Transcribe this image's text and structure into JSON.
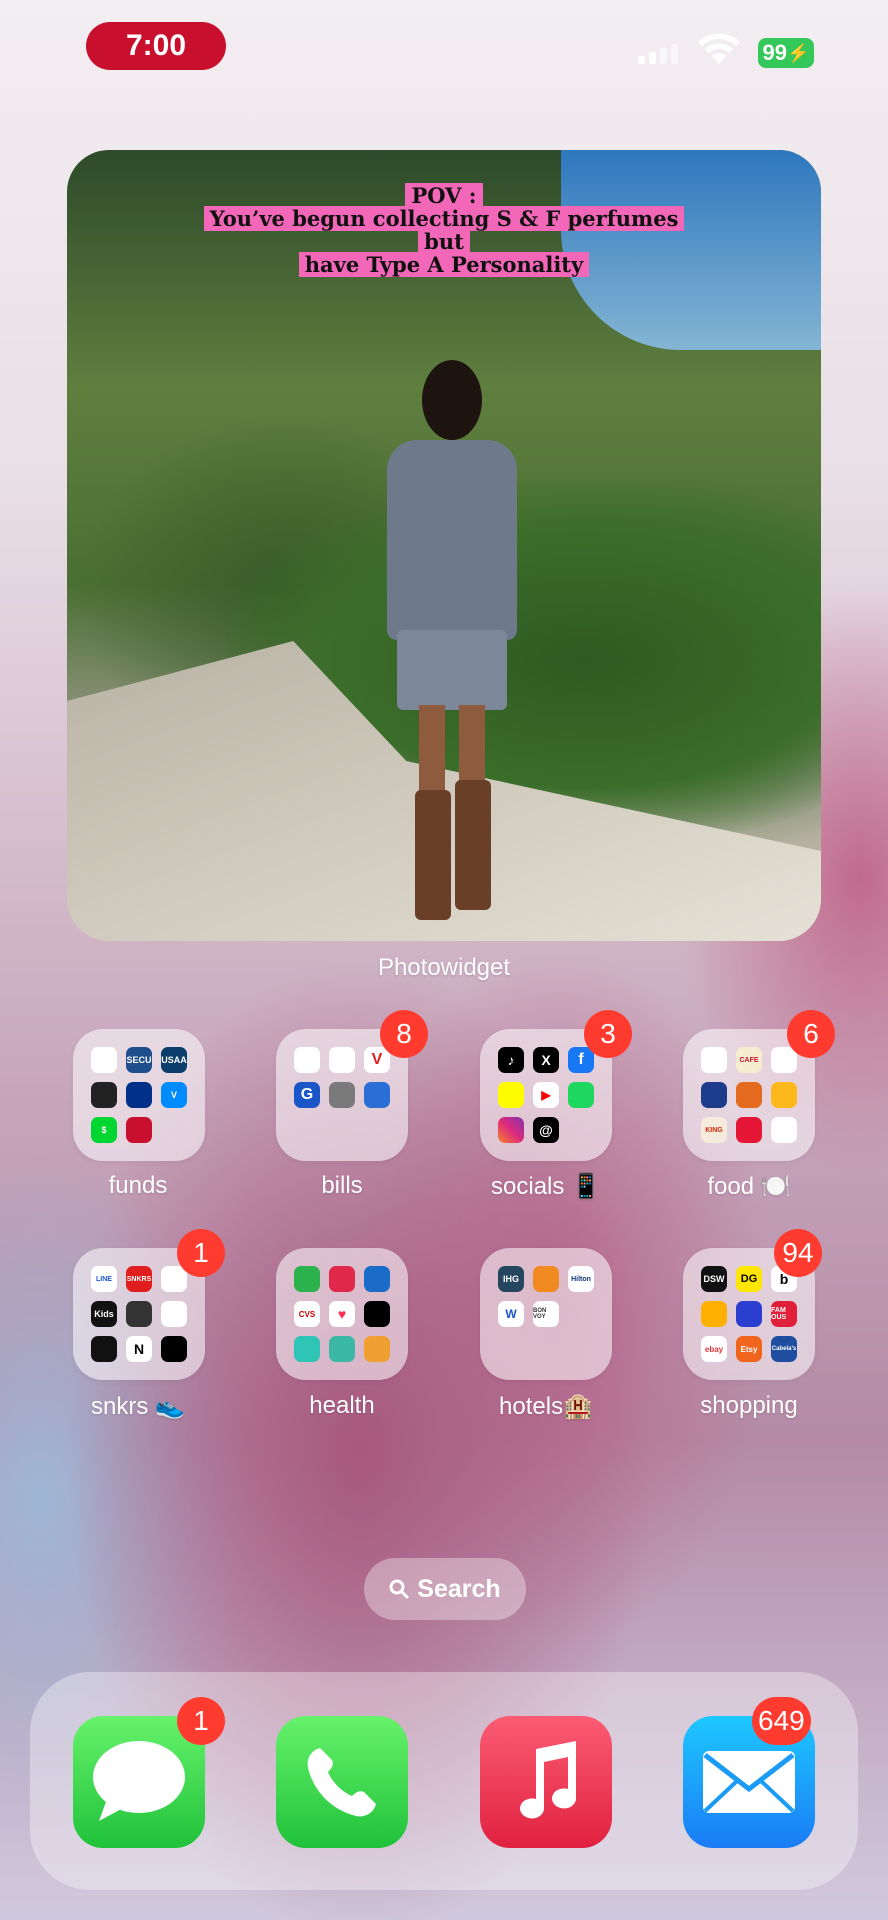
{
  "status_bar": {
    "time": "7:00",
    "battery": "99"
  },
  "widget": {
    "caption_lines": [
      "POV :",
      "You’ve begun collecting S & F perfumes",
      "but",
      "have Type A Personality"
    ],
    "label": "Photowidget"
  },
  "folders": [
    {
      "label": "funds",
      "badge": ""
    },
    {
      "label": "bills",
      "badge": "8"
    },
    {
      "label": "socials 📱",
      "badge": "3"
    },
    {
      "label": "food 🍽️",
      "badge": "6"
    },
    {
      "label": "snkrs 👟",
      "badge": "1"
    },
    {
      "label": "health",
      "badge": ""
    },
    {
      "label": "hotels🏨",
      "badge": ""
    },
    {
      "label": "shopping",
      "badge": "94"
    }
  ],
  "folder_icon_text": {
    "funds": [
      "",
      "SECU",
      "USAA",
      "",
      "",
      "V",
      "$",
      "",
      ""
    ],
    "bills": [
      "",
      "",
      "V",
      "G",
      "",
      "",
      "",
      "",
      ""
    ],
    "socials": [
      "♪",
      "X",
      "f",
      "",
      "▶",
      "",
      "",
      "@",
      ""
    ],
    "food": [
      "",
      "CAFE",
      "",
      "",
      "",
      "",
      "KING",
      "",
      ""
    ],
    "snkrs": [
      "LINE",
      "SNKRS",
      "",
      "Kids",
      "",
      "",
      "",
      "N",
      ""
    ],
    "health": [
      "",
      "",
      "",
      "CVS",
      "♥",
      "",
      "",
      "",
      ""
    ],
    "hotels": [
      "IHG",
      "",
      "Hilton",
      "W",
      "BON VOY",
      "",
      "",
      "",
      ""
    ],
    "shopping": [
      "DSW",
      "DG",
      "b",
      "",
      "",
      "FAM OUS",
      "ebay",
      "Etsy",
      "Cabela's"
    ]
  },
  "search": {
    "label": "Search"
  },
  "dock": [
    {
      "name": "messages",
      "badge": "1"
    },
    {
      "name": "phone",
      "badge": ""
    },
    {
      "name": "music",
      "badge": ""
    },
    {
      "name": "mail",
      "badge": "649"
    }
  ],
  "colors": {
    "badge": "#ff3b30",
    "time_pill": "#c8102e",
    "battery": "#34c759",
    "caption_highlight": "#f267b7"
  }
}
